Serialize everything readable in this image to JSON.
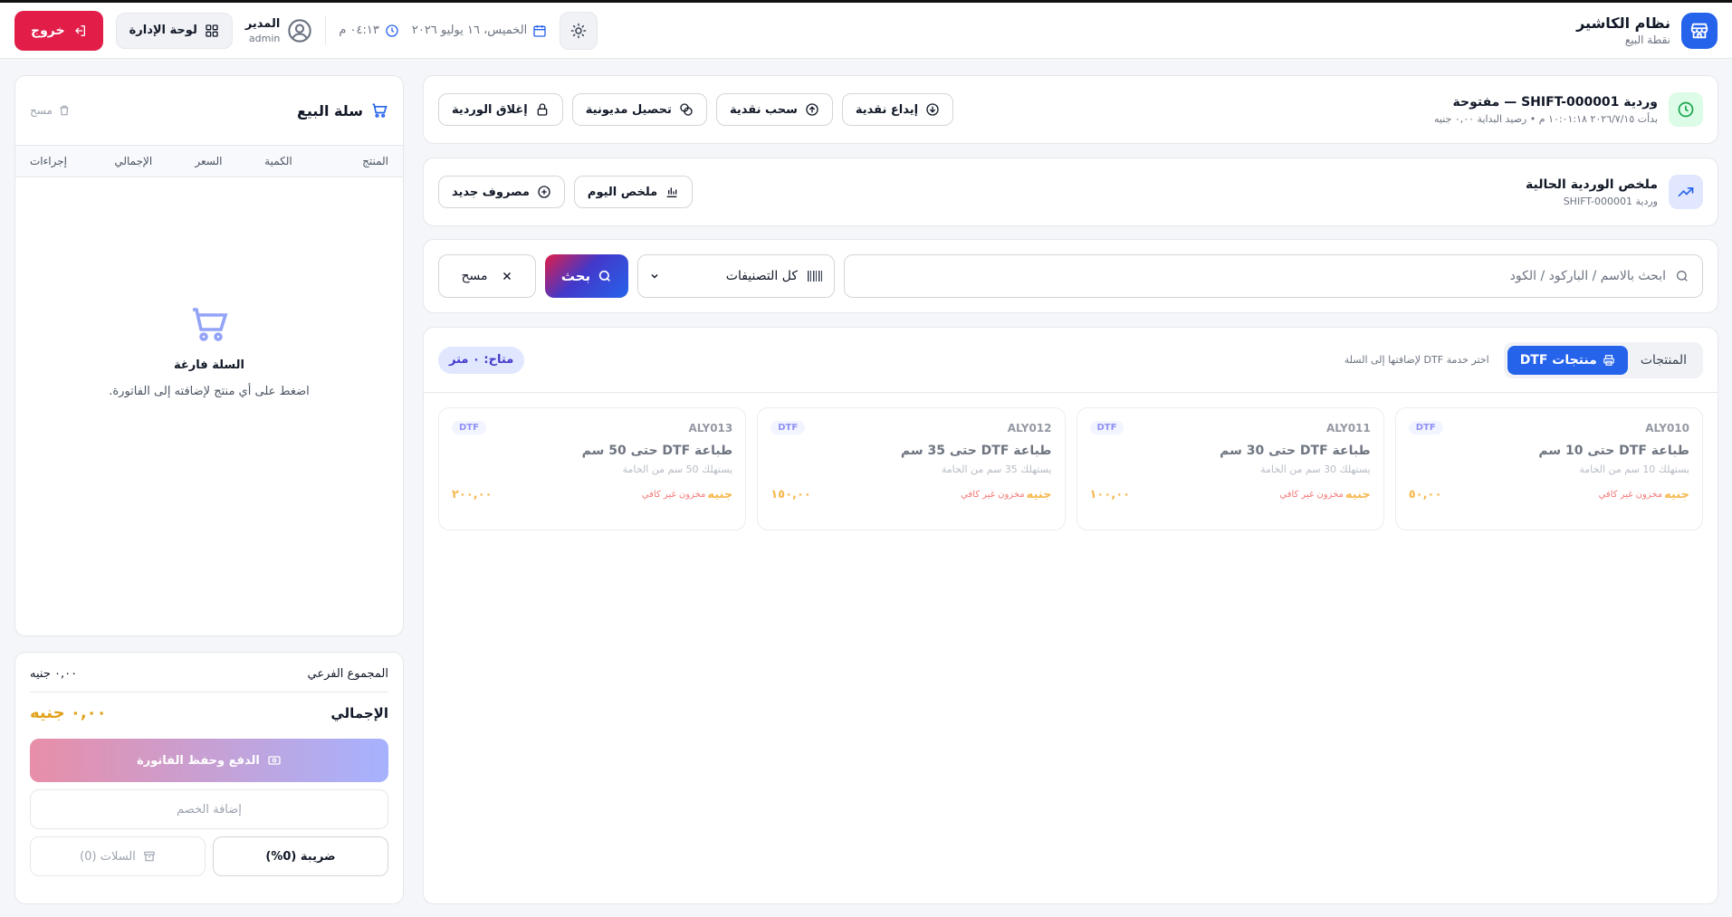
{
  "header": {
    "app_title": "نظام الكاشير",
    "app_subtitle": "نقطة البيع",
    "date": "الخميس، ١٦ يوليو ٢٠٢٦",
    "time": "٠٤:١٣ م",
    "user_name": "المدير",
    "user_role": "admin",
    "admin_label": "لوحة الإدارة",
    "logout_label": "خروج"
  },
  "shift": {
    "title": "وردية SHIFT-000001 — مفتوحة",
    "subtitle": "بدأت ٢٠٢٦/٧/١٥ ١٠:٠١:١٨ م • رصيد البداية ٠,٠٠ جنيه",
    "buttons": [
      "إيداع نقدية",
      "سحب نقدية",
      "تحصيل مديونية",
      "إغلاق الوردية"
    ]
  },
  "shift_summary": {
    "title": "ملخص الوردية الحالية",
    "subtitle": "وردية SHIFT-000001",
    "buttons": [
      "ملخص اليوم",
      "مصروف جديد"
    ]
  },
  "search": {
    "placeholder": "ابحث بالاسم / الباركود / الكود",
    "category": "كل التصنيفات",
    "search_label": "بحث",
    "clear_label": "مسح"
  },
  "products": {
    "tab_products": "المنتجات",
    "tab_dtf": "منتجات DTF",
    "hint": "اختر خدمة DTF لإضافتها إلى السلة",
    "available": "متاح: ٠ متر",
    "cards": [
      {
        "badge": "DTF",
        "code": "ALY010",
        "name": "طباعة DTF حتى 10 سم",
        "desc": "يستهلك 10 سم من الخامة",
        "price": "٥٠,٠٠",
        "currency": "جنيه",
        "stock": "مخزون غير كافي"
      },
      {
        "badge": "DTF",
        "code": "ALY011",
        "name": "طباعة DTF حتى 30 سم",
        "desc": "يستهلك 30 سم من الخامة",
        "price": "١٠٠,٠٠",
        "currency": "جنيه",
        "stock": "مخزون غير كافي"
      },
      {
        "badge": "DTF",
        "code": "ALY012",
        "name": "طباعة DTF حتى 35 سم",
        "desc": "يستهلك 35 سم من الخامة",
        "price": "١٥٠,٠٠",
        "currency": "جنيه",
        "stock": "مخزون غير كافي"
      },
      {
        "badge": "DTF",
        "code": "ALY013",
        "name": "طباعة DTF حتى 50 سم",
        "desc": "يستهلك 50 سم من الخامة",
        "price": "٢٠٠,٠٠",
        "currency": "جنيه",
        "stock": "مخزون غير كافي"
      }
    ]
  },
  "cart": {
    "title": "سلة البيع",
    "clear_label": "مسح",
    "columns": [
      "المنتج",
      "الكمية",
      "السعر",
      "الإجمالي",
      "إجراءات"
    ],
    "empty_title": "السلة فارغة",
    "empty_sub": "اضغط على أي منتج لإضافته إلى الفاتورة."
  },
  "summary": {
    "subtotal_label": "المجموع الفرعي",
    "subtotal_value": "٠,٠٠ جنيه",
    "total_label": "الإجمالي",
    "total_value": "٠,٠٠ جنيه",
    "pay_label": "الدفع وحفظ الفاتورة",
    "discount_label": "إضافة الخصم",
    "tax_label": "ضريبة (0%)",
    "carts_label": "السلات (0)"
  },
  "colors": {
    "primary": "#2563eb",
    "danger": "#e11d48",
    "price": "#e0a21a"
  }
}
